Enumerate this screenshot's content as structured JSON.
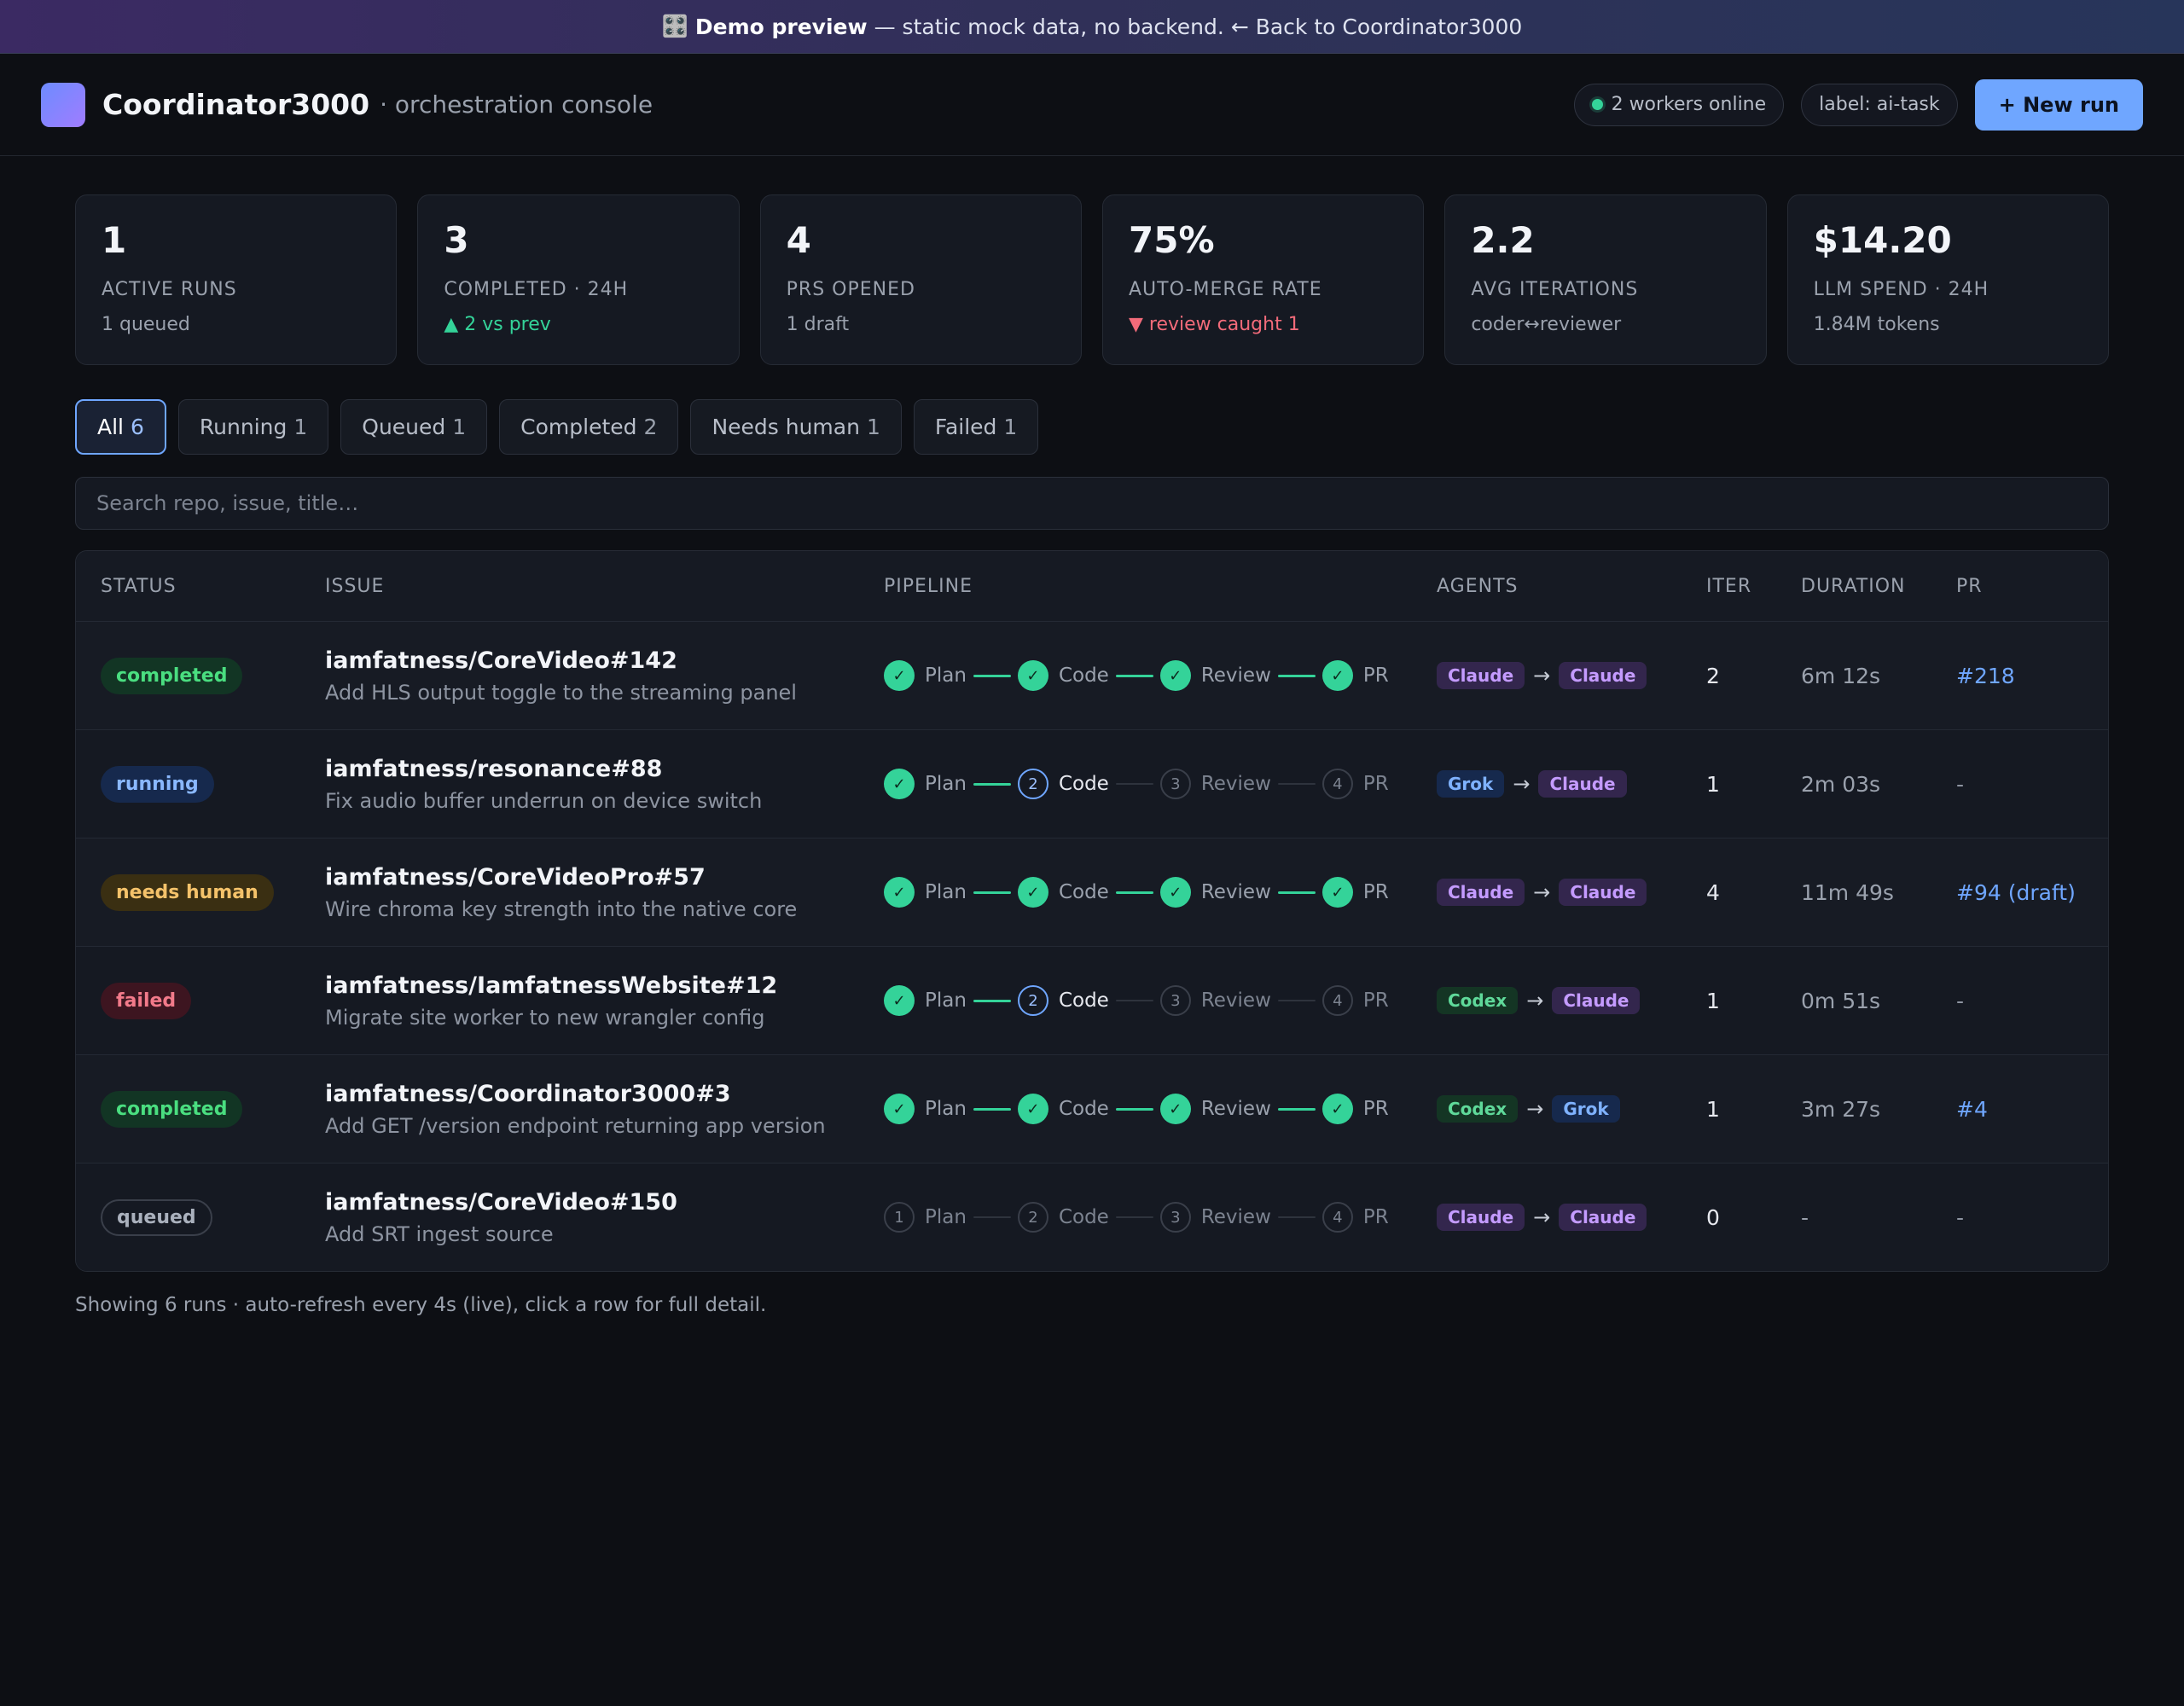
{
  "banner": {
    "icon": "🎛️",
    "bold": "Demo preview",
    "rest": "— static mock data, no backend.",
    "back_link": "← Back to Coordinator3000"
  },
  "header": {
    "title": "Coordinator3000",
    "subtitle": "· orchestration console",
    "workers": "2 workers online",
    "label_pill": "label: ai-task",
    "new_run": "+ New run"
  },
  "stats": [
    {
      "value": "1",
      "label": "ACTIVE RUNS",
      "sub": "1 queued",
      "tone": "neutral"
    },
    {
      "value": "3",
      "label": "COMPLETED · 24H",
      "sub": "▲ 2 vs prev",
      "tone": "up"
    },
    {
      "value": "4",
      "label": "PRS OPENED",
      "sub": "1 draft",
      "tone": "neutral"
    },
    {
      "value": "75%",
      "label": "AUTO-MERGE RATE",
      "sub": "▼ review caught 1",
      "tone": "down"
    },
    {
      "value": "2.2",
      "label": "AVG ITERATIONS",
      "sub": "coder↔reviewer",
      "tone": "neutral"
    },
    {
      "value": "$14.20",
      "label": "LLM SPEND · 24H",
      "sub": "1.84M tokens",
      "tone": "neutral"
    }
  ],
  "filters": [
    {
      "label": "All",
      "count": "6",
      "active": true
    },
    {
      "label": "Running",
      "count": "1",
      "active": false
    },
    {
      "label": "Queued",
      "count": "1",
      "active": false
    },
    {
      "label": "Completed",
      "count": "2",
      "active": false
    },
    {
      "label": "Needs human",
      "count": "1",
      "active": false
    },
    {
      "label": "Failed",
      "count": "1",
      "active": false
    }
  ],
  "search": {
    "placeholder": "Search repo, issue, title…",
    "value": ""
  },
  "table": {
    "columns": [
      "STATUS",
      "ISSUE",
      "PIPELINE",
      "AGENTS",
      "ITER",
      "DURATION",
      "PR"
    ],
    "pipeline_steps": [
      "Plan",
      "Code",
      "Review",
      "PR"
    ],
    "rows": [
      {
        "status": "completed",
        "status_class": "completed",
        "repo": "iamfatness/CoreVideo#142",
        "title": "Add HLS output toggle to the streaming panel",
        "progress": 4,
        "agents": [
          "Claude",
          "Claude"
        ],
        "iter": "2",
        "duration": "6m 12s",
        "pr": "#218"
      },
      {
        "status": "running",
        "status_class": "running",
        "repo": "iamfatness/resonance#88",
        "title": "Fix audio buffer underrun on device switch",
        "progress": 1,
        "agents": [
          "Grok",
          "Claude"
        ],
        "iter": "1",
        "duration": "2m 03s",
        "pr": "-"
      },
      {
        "status": "needs human",
        "status_class": "needs",
        "repo": "iamfatness/CoreVideoPro#57",
        "title": "Wire chroma key strength into the native core",
        "progress": 4,
        "agents": [
          "Claude",
          "Claude"
        ],
        "iter": "4",
        "duration": "11m 49s",
        "pr": "#94 (draft)"
      },
      {
        "status": "failed",
        "status_class": "failed",
        "repo": "iamfatness/IamfatnessWebsite#12",
        "title": "Migrate site worker to new wrangler config",
        "progress": 1,
        "agents": [
          "Codex",
          "Claude"
        ],
        "iter": "1",
        "duration": "0m 51s",
        "pr": "-"
      },
      {
        "status": "completed",
        "status_class": "completed",
        "repo": "iamfatness/Coordinator3000#3",
        "title": "Add GET /version endpoint returning app version",
        "progress": 4,
        "agents": [
          "Codex",
          "Grok"
        ],
        "iter": "1",
        "duration": "3m 27s",
        "pr": "#4"
      },
      {
        "status": "queued",
        "status_class": "queued",
        "repo": "iamfatness/CoreVideo#150",
        "title": "Add SRT ingest source",
        "progress": 0,
        "agents": [
          "Claude",
          "Claude"
        ],
        "iter": "0",
        "duration": "-",
        "pr": "-"
      }
    ]
  },
  "footer": "Showing 6 runs · auto-refresh every 4s (live), click a row for full detail."
}
